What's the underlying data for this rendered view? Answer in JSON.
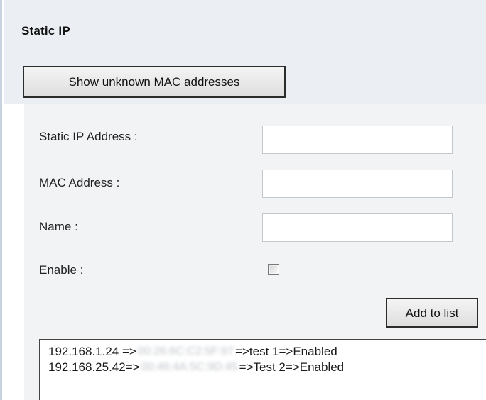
{
  "section": {
    "title": "Static IP"
  },
  "buttons": {
    "show_unknown_mac": "Show unknown MAC addresses",
    "add_to_list": "Add to list"
  },
  "form": {
    "static_ip_label": "Static IP Address :",
    "static_ip_value": "",
    "mac_label": "MAC Address :",
    "mac_value": "",
    "name_label": "Name :",
    "name_value": "",
    "enable_label": "Enable :",
    "enable_checked": false
  },
  "list": {
    "items": [
      {
        "ip": "192.168.1.24 =>",
        "mac": "00:26:6C:C2:5F:97",
        "suffix": "=>test 1=>Enabled"
      },
      {
        "ip": "192.168.25.42=>",
        "mac": "00:46:4A:5C:9D:45",
        "suffix": "=>Test 2=>Enabled"
      }
    ]
  }
}
